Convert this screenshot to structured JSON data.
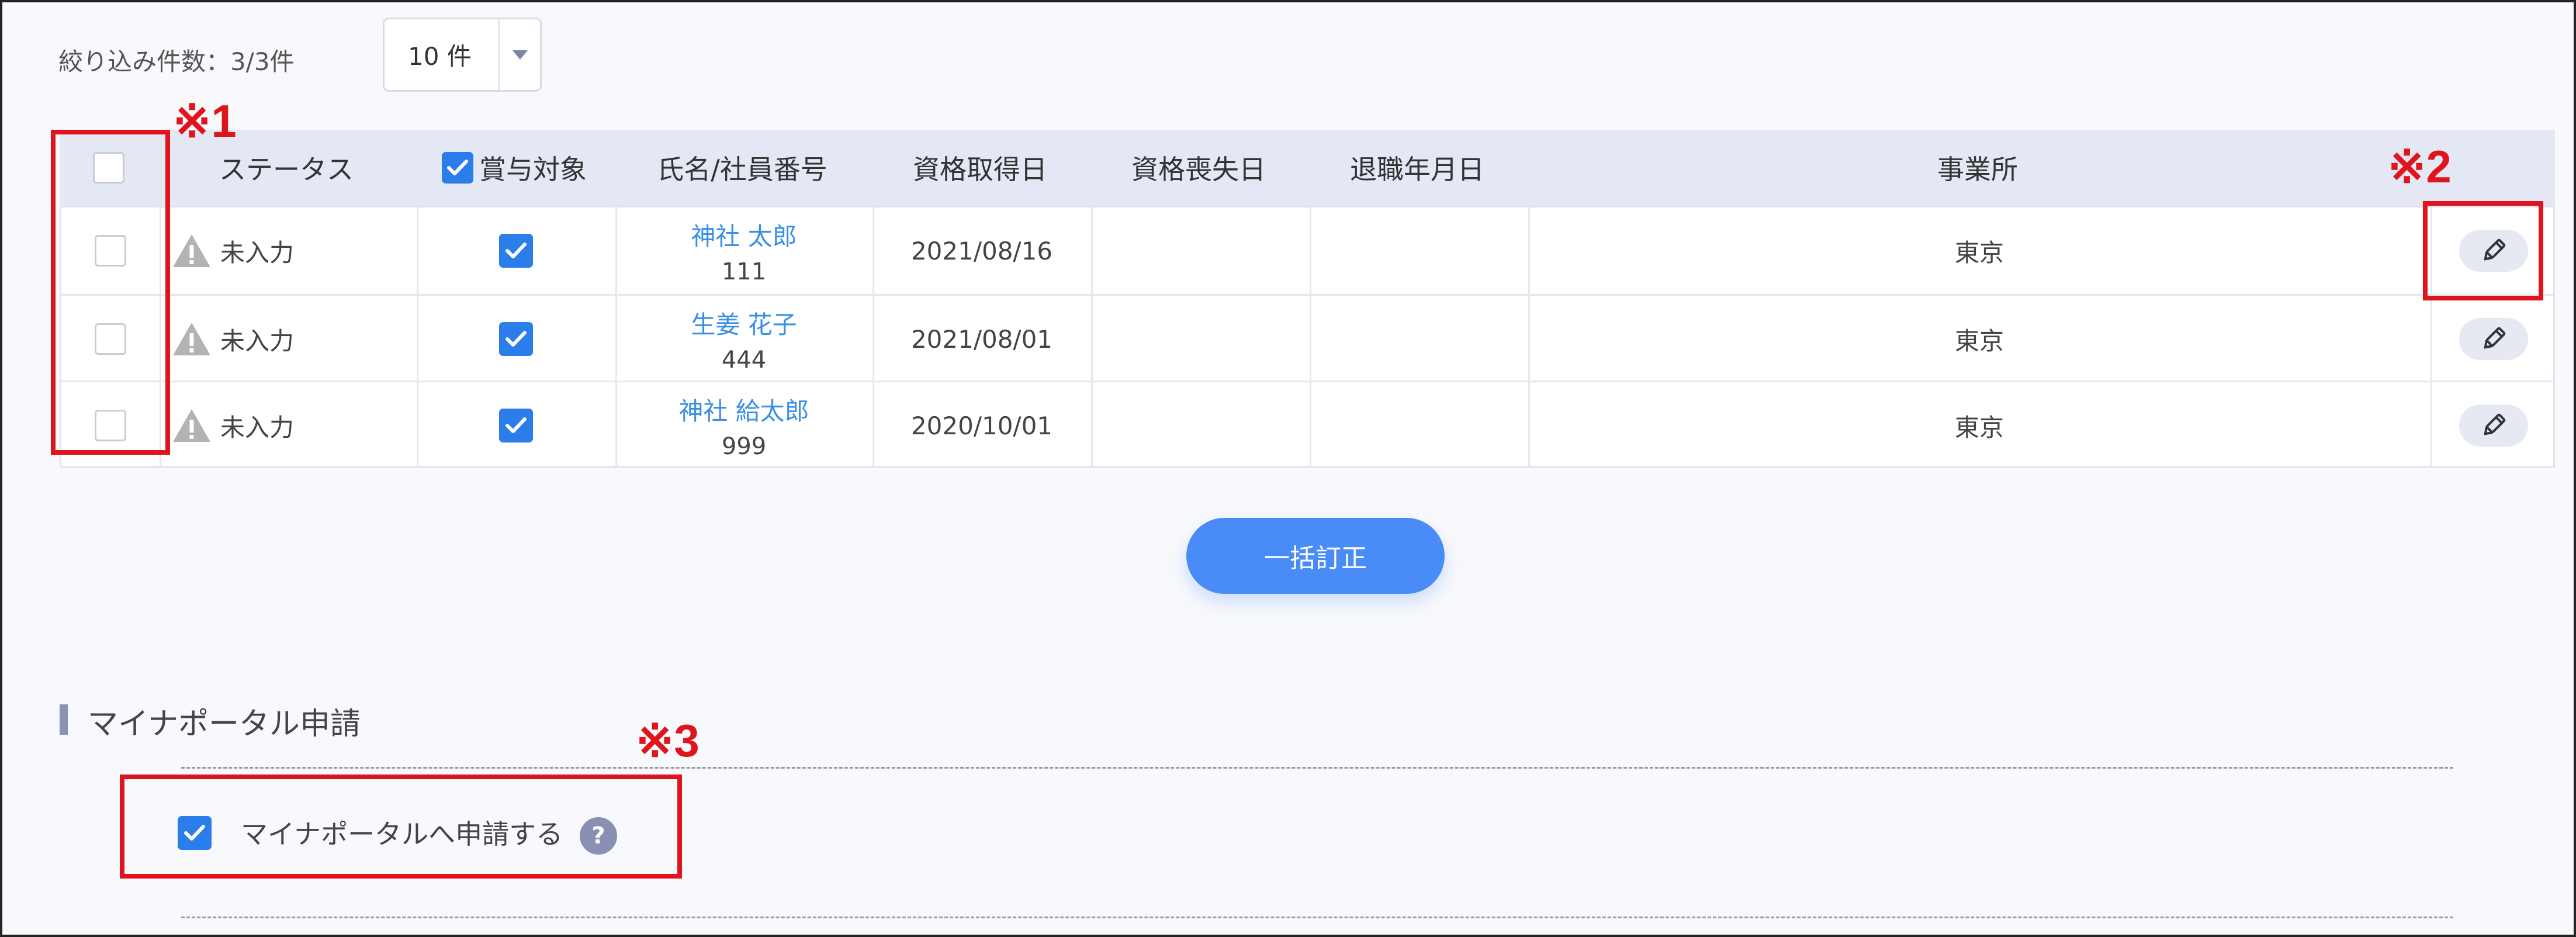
{
  "filter": {
    "count_label": "絞り込み件数：3/3件",
    "per_page": "10 件"
  },
  "table": {
    "headers": {
      "status": "ステータス",
      "bonus_target": "賞与対象",
      "name": "氏名/社員番号",
      "acquired": "資格取得日",
      "lost": "資格喪失日",
      "retired": "退職年月日",
      "office": "事業所"
    },
    "rows": [
      {
        "status": "未入力",
        "name": "神社 太郎",
        "emp_no": "111",
        "acquired": "2021/08/16",
        "lost": "",
        "retired": "",
        "office": "東京"
      },
      {
        "status": "未入力",
        "name": "生姜 花子",
        "emp_no": "444",
        "acquired": "2021/08/01",
        "lost": "",
        "retired": "",
        "office": "東京"
      },
      {
        "status": "未入力",
        "name": "神社 給太郎",
        "emp_no": "999",
        "acquired": "2020/10/01",
        "lost": "",
        "retired": "",
        "office": "東京"
      }
    ]
  },
  "bulk_button": "一括訂正",
  "section": {
    "title": "マイナポータル申請",
    "checkbox_label": "マイナポータルへ申請する",
    "help": "?"
  },
  "annotations": {
    "mark1": "※1",
    "mark2": "※2",
    "mark3": "※3"
  },
  "colors": {
    "accent": "#4a8cf7",
    "checkbox": "#2b7de9",
    "link": "#3a8fe6",
    "annotation": "#e0141c"
  },
  "icons": {
    "status": "warning-icon",
    "edit": "pencil-icon",
    "help": "help-icon",
    "dropdown": "caret-down-icon"
  }
}
